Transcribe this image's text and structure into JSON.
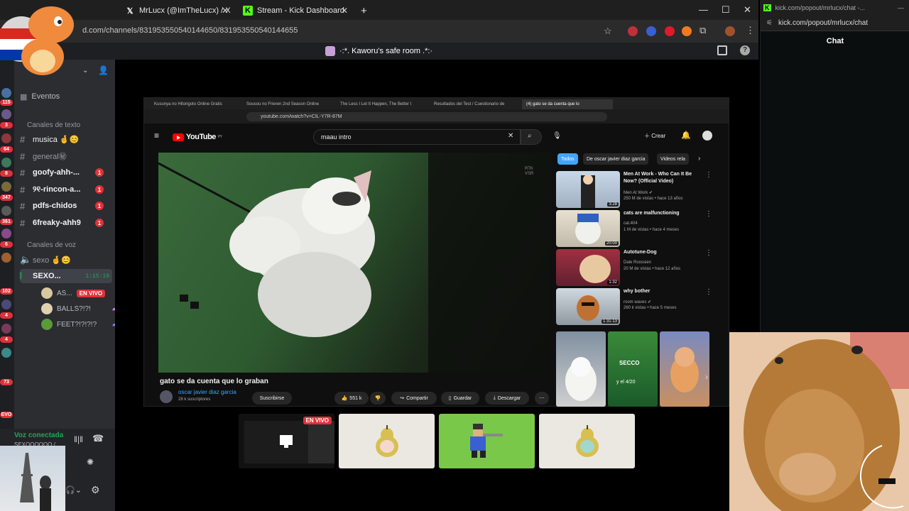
{
  "browser": {
    "tabs": [
      {
        "label": "MrLucx (@ImTheLucx) / X"
      },
      {
        "label": "Stream - Kick Dashboard"
      }
    ],
    "url": "d.com/channels/831953550540144650/831953550540144655"
  },
  "discord": {
    "server_title": "·:*. Kaworu's safe room .*:·",
    "events_label": "Eventos",
    "text_category": "Canales de texto",
    "text_channels": [
      {
        "name": "musica 🤞😊",
        "badge": ""
      },
      {
        "name": "general㊙",
        "badge": ""
      },
      {
        "name": "goofy-ahh-...",
        "badge": "1"
      },
      {
        "name": "୨୧-rincon-a...",
        "badge": "1"
      },
      {
        "name": "pdfs-chidos",
        "badge": "1"
      },
      {
        "name": "6freaky-ahh9",
        "badge": "1"
      }
    ],
    "voice_category": "Canales de voz",
    "voice_channels": [
      {
        "name": "sexo 🤞😊"
      },
      {
        "name": "SEXO...",
        "timer": "1:15:19"
      }
    ],
    "voice_users": [
      {
        "name": "AS...",
        "live": "EN VIVO"
      },
      {
        "name": "BALLS?!?!",
        "live": ""
      },
      {
        "name": "FEET?!?!?!?",
        "live": ""
      }
    ],
    "rail_badges": [
      "115",
      "3",
      "64",
      "8",
      "347",
      "361",
      "6",
      "102",
      "4",
      "4",
      "73",
      "EVO"
    ],
    "voice_connected": "Voz conectada",
    "voice_sub": "SEXOOOOOO / ..."
  },
  "screenshare": {
    "tabs": [
      "Kusunya no Hitorigoto Online Gratis",
      "Sousou no Frieren 2nd Season Online",
      "The Less I Let It Happen, The Better I",
      "Resultados del Test / Cuestionario de",
      "(4) gato se da cuenta que lo"
    ],
    "url": "youtube.com/watch?v=CIL-Y7R-87M",
    "yt_logo": "YouTube",
    "yt_region": "PY",
    "search_value": "maau intro",
    "create_label": "Crear",
    "watermark": "RTK VSR",
    "video_title": "gato se da cuenta que lo graban",
    "channel_name": "oscar javier diaz garcia",
    "subscribers": "28 k suscriptores",
    "subscribe_label": "Suscribirse",
    "likes": "551 k",
    "share_label": "Compartir",
    "save_label": "Guardar",
    "download_label": "Descargar",
    "chips": [
      "Todos",
      "De oscar javier diaz garcia",
      "Videos rela"
    ],
    "recommendations": [
      {
        "title": "Men At Work - Who Can It Be Now? (Official Video)",
        "channel": "Men At Work ✔",
        "meta": "250 M de vistas • hace 13 años",
        "duration": "3:28"
      },
      {
        "title": "cats are malfunctioning",
        "channel": "cat.404",
        "meta": "1 M de vistas • hace 4 meses",
        "duration": "20:00"
      },
      {
        "title": "Autotune-Dog",
        "channel": "Dale Roossien",
        "meta": "20 M de vistas • hace 12 años",
        "duration": "1:32"
      },
      {
        "title": "why bother",
        "channel": "room waves ✔",
        "meta": "260 k vistas • hace 5 meses",
        "duration": "1:31:13"
      }
    ],
    "short_text": [
      "SECCO",
      "y el 4/20"
    ]
  },
  "stage": {
    "live_badge": "EN VIVO"
  },
  "kick": {
    "tab_url": "kick.com/popout/mrlucx/chat -...",
    "url": "kick.com/popout/mrlucx/chat",
    "chat_title": "Chat"
  },
  "colors": {
    "discord_bg": "#2b2d31",
    "accent_red": "#e0313a",
    "kick_green": "#53fc18",
    "youtube_red": "#ff0000"
  }
}
